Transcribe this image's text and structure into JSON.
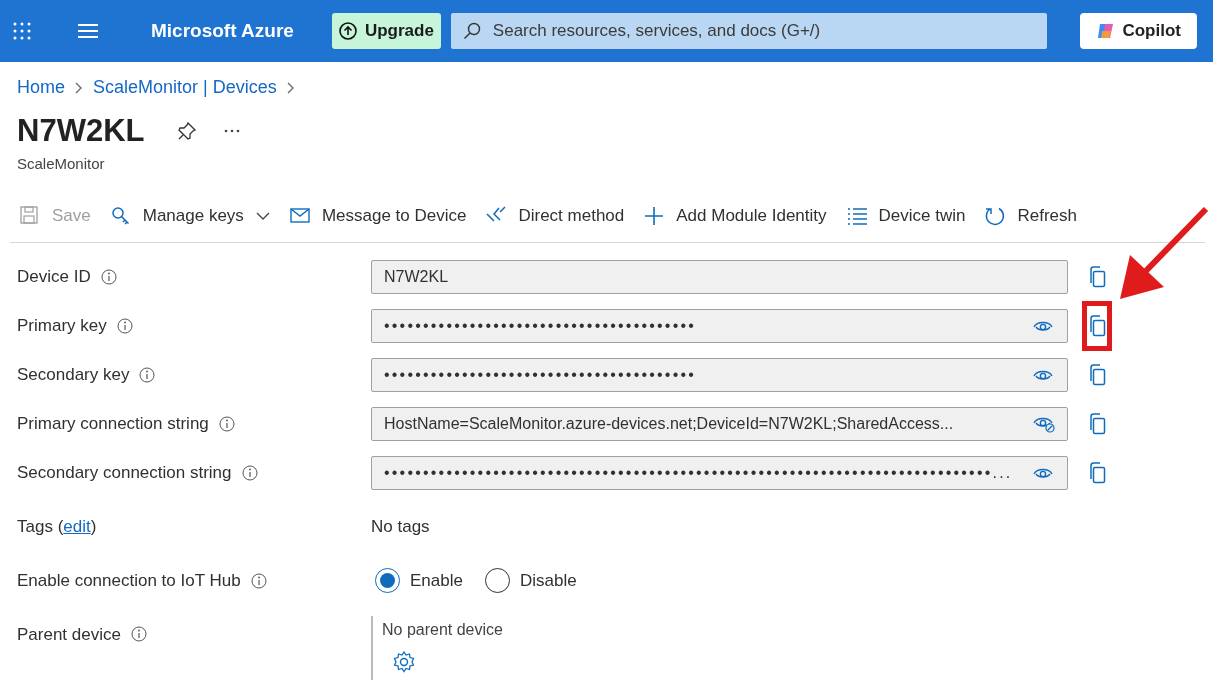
{
  "topbar": {
    "brand": "Microsoft Azure",
    "upgrade": "Upgrade",
    "search": {
      "placeholder": "Search resources, services, and docs (G+/)"
    },
    "copilot": "Copilot"
  },
  "breadcrumb": [
    "Home",
    "ScaleMonitor | Devices"
  ],
  "title": "N7W2KL",
  "subtitle": "ScaleMonitor",
  "toolbar": [
    {
      "label": "Save",
      "disabled": true,
      "dropdown": false
    },
    {
      "label": "Manage keys",
      "disabled": false,
      "dropdown": true
    },
    {
      "label": "Message to Device",
      "disabled": false,
      "dropdown": false
    },
    {
      "label": "Direct method",
      "disabled": false,
      "dropdown": false
    },
    {
      "label": "Add Module Identity",
      "disabled": false,
      "dropdown": false
    },
    {
      "label": "Device twin",
      "disabled": false,
      "dropdown": false
    },
    {
      "label": "Refresh",
      "disabled": false,
      "dropdown": false
    }
  ],
  "fields": [
    {
      "label": "Device ID",
      "kind": "text",
      "value": "N7W2KL",
      "highlighted": false
    },
    {
      "label": "Primary key",
      "kind": "secret",
      "value": "••••••••••••••••••••••••••••••••••••••••",
      "revealed": false,
      "highlighted": true
    },
    {
      "label": "Secondary key",
      "kind": "secret",
      "value": "••••••••••••••••••••••••••••••••••••••••",
      "revealed": false,
      "highlighted": false
    },
    {
      "label": "Primary connection string",
      "kind": "secret",
      "value": "HostName=ScaleMonitor.azure-devices.net;DeviceId=N7W2KL;SharedAccess...",
      "revealed": true,
      "highlighted": false
    },
    {
      "label": "Secondary connection string",
      "kind": "secret",
      "value": "••••••••••••••••••••••••••••••••••••••••••••••••••••••••••••••••••••••••••••••...",
      "revealed": false,
      "highlighted": false
    }
  ],
  "tags": {
    "label": "Tags (",
    "link": "edit",
    "label_end": ")",
    "value": "No tags"
  },
  "connection": {
    "label": "Enable connection to IoT Hub",
    "options": [
      {
        "label": "Enable",
        "selected": true
      },
      {
        "label": "Disable",
        "selected": false
      }
    ]
  },
  "parent": {
    "label": "Parent device",
    "value": "No parent device"
  }
}
